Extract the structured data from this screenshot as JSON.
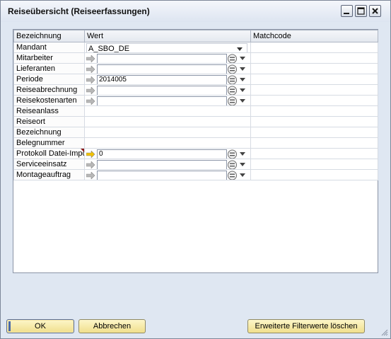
{
  "window": {
    "title": "Reiseübersicht (Reiseerfassungen)",
    "controls": [
      "minimize-icon",
      "maximize-icon",
      "close-icon"
    ]
  },
  "grid": {
    "headers": [
      "Bezeichnung",
      "Wert",
      "Matchcode"
    ],
    "rows": [
      {
        "label": "Mandant",
        "type": "select",
        "value": "A_SBO_DE"
      },
      {
        "label": "Mitarbeiter",
        "type": "field",
        "value": ""
      },
      {
        "label": "Lieferanten",
        "type": "field",
        "value": ""
      },
      {
        "label": "Periode",
        "type": "field",
        "value": "2014005"
      },
      {
        "label": "Reiseabrechnung",
        "type": "field",
        "value": ""
      },
      {
        "label": "Reisekostenarten",
        "type": "field",
        "value": ""
      },
      {
        "label": "Reiseanlass",
        "type": "empty",
        "value": ""
      },
      {
        "label": "Reiseort",
        "type": "empty",
        "value": ""
      },
      {
        "label": "Bezeichnung",
        "type": "empty",
        "value": ""
      },
      {
        "label": "Belegnummer",
        "type": "empty",
        "value": ""
      },
      {
        "label": "Protokoll Datei-Impo",
        "type": "field",
        "value": "0",
        "arrow_color": "#f2c200",
        "marked": true
      },
      {
        "label": "Serviceeinsatz",
        "type": "field",
        "value": ""
      },
      {
        "label": "Montageauftrag",
        "type": "field",
        "value": ""
      }
    ]
  },
  "buttons": {
    "ok": "OK",
    "cancel": "Abbrechen",
    "clear_filters": "Erweiterte Filterwerte löschen"
  },
  "colors": {
    "button_face": "#f0df8c",
    "window_bg": "#dfe7f2",
    "arrow_default": "#b8b8b8",
    "arrow_active": "#f2c200"
  }
}
